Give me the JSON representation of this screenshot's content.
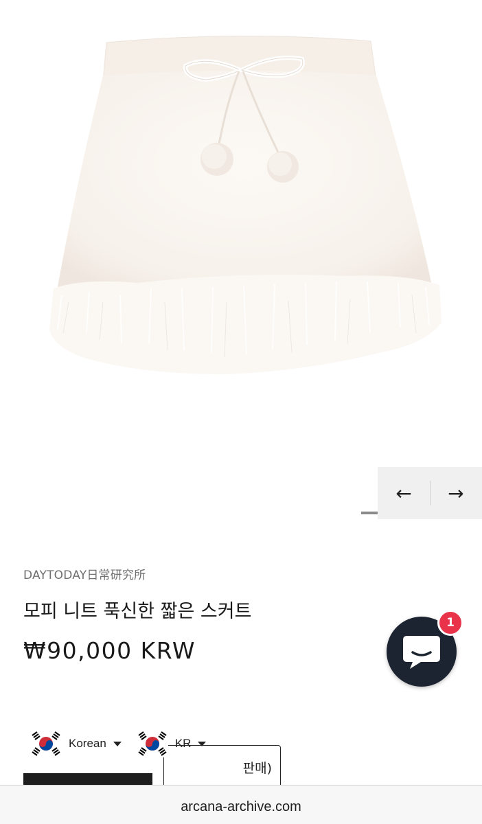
{
  "product": {
    "image_alt": "white faux fur knit mini skirt with bow and pompoms",
    "vendor": "DAYTODAY日常研究所",
    "title": "모피 니트 푹신한 짧은 스커트",
    "price": "₩90,000 KRW"
  },
  "slider": {
    "prev_icon": "←",
    "next_icon": "→"
  },
  "chat": {
    "badge_count": "1"
  },
  "buttons": {
    "outline_partial_label": "판매)"
  },
  "locale": {
    "language": "Korean",
    "country": "KR"
  },
  "browser": {
    "url": "arcana-archive.com"
  },
  "colors": {
    "chat_bg": "#1c2431",
    "badge": "#e8334a",
    "skirt": "#fbf6f1"
  }
}
